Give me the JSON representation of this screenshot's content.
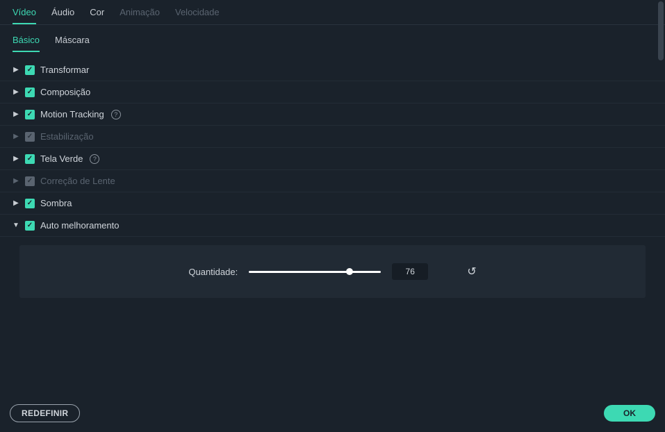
{
  "mainTabs": {
    "video": "Vídeo",
    "audio": "Áudio",
    "color": "Cor",
    "animation": "Animação",
    "speed": "Velocidade"
  },
  "subTabs": {
    "basic": "Básico",
    "mask": "Máscara"
  },
  "sections": {
    "transform": "Transformar",
    "composition": "Composição",
    "motionTracking": "Motion Tracking",
    "stabilization": "Estabilização",
    "greenScreen": "Tela Verde",
    "lensCorrection": "Correção de Lente",
    "shadow": "Sombra",
    "autoEnhance": "Auto melhoramento"
  },
  "autoEnhance": {
    "quantityLabel": "Quantidade:",
    "quantityValue": "76",
    "sliderPercent": 76
  },
  "footer": {
    "redefine": "REDEFINIR",
    "ok": "OK"
  }
}
